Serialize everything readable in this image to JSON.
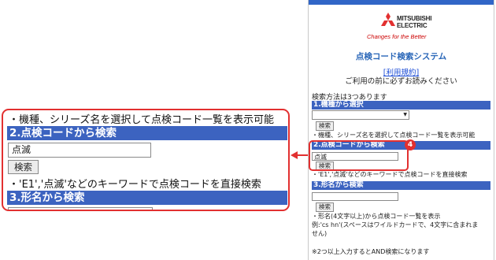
{
  "brand": {
    "name_line1": "MITSUBISHI",
    "name_line2": "ELECTRIC",
    "tagline": "Changes for the Better",
    "logo_color": "#e23030"
  },
  "system_title": "点検コード検索システム",
  "terms": {
    "link": "[利用規約]",
    "note": "ご利用の前に必ずお読みください"
  },
  "methods_intro": "検索方法は3つあります",
  "sections": [
    {
      "heading": "1.機種から選択",
      "button": "検索",
      "description": "・機種、シリーズ名を選択して点検コード一覧を表示可能"
    },
    {
      "heading": "2.点検コードから検索",
      "input_value": "点滅",
      "button": "検索",
      "description": "・'E1','点滅'などのキーワードで点検コードを直接検索"
    },
    {
      "heading": "3.形名から検索",
      "button": "検索",
      "description_line1": "・形名(4文字以上)から点検コード一覧を表示",
      "description_line2": "例:'cs hn'(スペースはワイルドカードで、4文字に含まれま",
      "description_line3": "せん)"
    }
  ],
  "footer_note": "※2つ以上入力するとAND検索になります",
  "callout": {
    "badge": "4",
    "top_text": "・機種、シリーズ名を選択して点検コード一覧を表示可能",
    "heading": "2.点検コードから検索",
    "input_value": "点滅",
    "button": "検索",
    "description": "・'E1','点滅'などのキーワードで点検コードを直接検索",
    "next_heading": "3.形名から検索"
  },
  "colors": {
    "header_blue": "#3c63c0",
    "title_blue": "#2966b8",
    "highlight_red": "#e23030"
  }
}
